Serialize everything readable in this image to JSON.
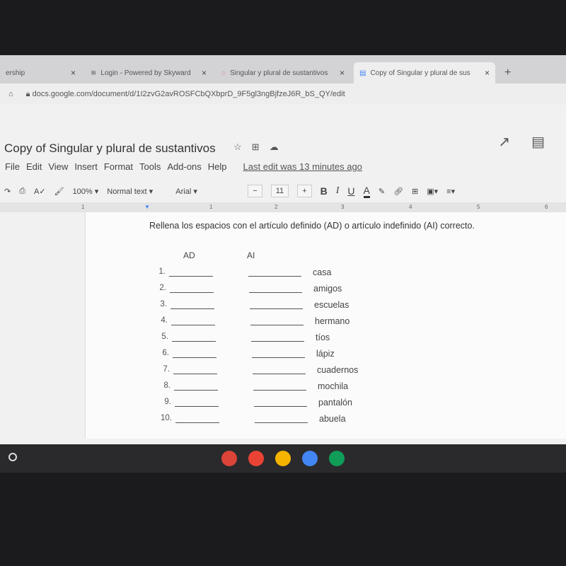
{
  "browser": {
    "tabs": [
      {
        "label": "ership",
        "close": "×"
      },
      {
        "label": "Login - Powered by Skyward",
        "close": "×"
      },
      {
        "label": "Singular y plural de sustantivos",
        "close": "×"
      },
      {
        "label": "Copy of Singular y plural de sus",
        "close": "×",
        "active": true
      }
    ],
    "new_tab": "+",
    "url": "docs.google.com/document/d/1I2zvG2avROSFCbQXbprD_9F5gl3ngBjfzeJ6R_bS_QY/edit"
  },
  "doc": {
    "title": "Copy of Singular y plural de sustantivos",
    "menu": [
      "File",
      "Edit",
      "View",
      "Insert",
      "Format",
      "Tools",
      "Add-ons",
      "Help"
    ],
    "last_edit": "Last edit was 13 minutes ago",
    "toolbar": {
      "zoom": "100%",
      "style": "Normal text",
      "font": "Arial",
      "minus": "−",
      "size": "11",
      "plus": "+",
      "bold": "B",
      "italic": "I",
      "underline": "U",
      "color": "A"
    },
    "ruler": [
      "1",
      "1",
      "2",
      "3",
      "4",
      "5",
      "6"
    ],
    "instruction": "Rellena los espacios con el artículo definido (AD) o artículo indefinido (AI) correcto.",
    "columns": {
      "ad": "AD",
      "ai": "AI"
    },
    "items": [
      {
        "n": "1.",
        "word": "casa"
      },
      {
        "n": "2.",
        "word": "amigos"
      },
      {
        "n": "3.",
        "word": "escuelas"
      },
      {
        "n": "4.",
        "word": "hermano"
      },
      {
        "n": "5.",
        "word": "tíos"
      },
      {
        "n": "6.",
        "word": "lápiz"
      },
      {
        "n": "7.",
        "word": "cuadernos"
      },
      {
        "n": "8.",
        "word": "mochila"
      },
      {
        "n": "9.",
        "word": "pantalón"
      },
      {
        "n": "10.",
        "word": "abuela"
      }
    ]
  },
  "taskbar": {
    "apps": [
      "chrome",
      "gmail",
      "google-photos",
      "google-docs",
      "play-store"
    ],
    "colors": [
      "#db4437",
      "#ea4335",
      "#f4b400",
      "#4285f4",
      "#0f9d58"
    ]
  }
}
